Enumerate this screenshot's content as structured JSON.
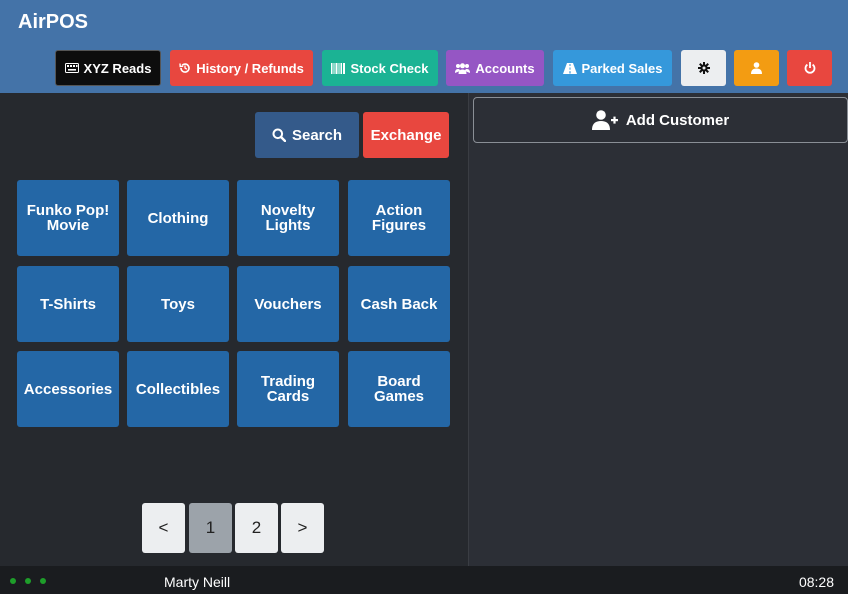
{
  "app": {
    "title": "AirPOS"
  },
  "toolbar": {
    "xyz_reads": "XYZ Reads",
    "history_refunds": "History / Refunds",
    "stock_check": "Stock Check",
    "accounts": "Accounts",
    "parked_sales": "Parked Sales",
    "icons": [
      "keyboard-icon",
      "history-icon",
      "barcode-icon",
      "users-icon",
      "road-icon",
      "gear-icon",
      "user-icon",
      "power-icon"
    ]
  },
  "actions": {
    "search": "Search",
    "exchange": "Exchange"
  },
  "categories": [
    [
      "Funko Pop!",
      "Movie"
    ],
    [
      "Clothing"
    ],
    [
      "Novelty",
      "Lights"
    ],
    [
      "Action",
      "Figures"
    ],
    [
      "T-Shirts"
    ],
    [
      "Toys"
    ],
    [
      "Vouchers"
    ],
    [
      "Cash Back"
    ],
    [
      "Accessories"
    ],
    [
      "Collectibles"
    ],
    [
      "Trading",
      "Cards"
    ],
    [
      "Board",
      "Games"
    ]
  ],
  "pagination": {
    "prev": "<",
    "pages": [
      "1",
      "2"
    ],
    "current": "1",
    "next": ">"
  },
  "customer": {
    "add_label": "Add Customer"
  },
  "footer": {
    "user": "Marty Neill",
    "time": "08:28"
  },
  "colors": {
    "header": "#4473a8",
    "xyz_reads": "#0d0d0d",
    "history_refunds": "#e8473f",
    "stock_check": "#1bb394",
    "accounts": "#9556c4",
    "parked_sales": "#3598db",
    "settings": "#eceef0",
    "user": "#f39c12",
    "logout": "#e8473f",
    "search": "#345a8a",
    "exchange": "#e8473f",
    "tile": "#2467a6"
  }
}
